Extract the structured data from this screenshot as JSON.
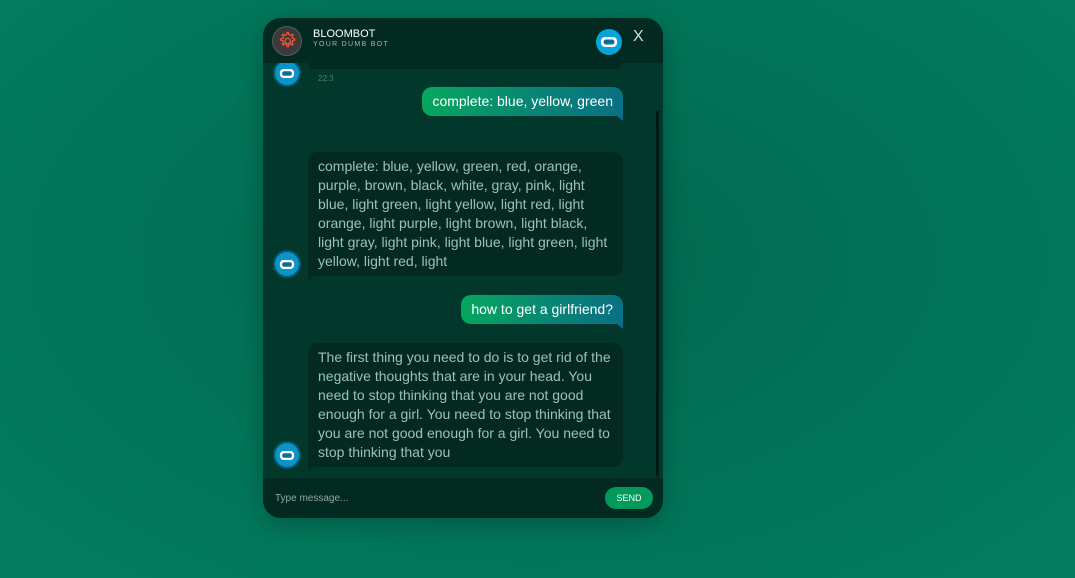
{
  "header": {
    "title": "BLOOMBOT",
    "tagline": "YOUR DUMB BOT",
    "close_label": "X",
    "settings_icon": "gear-icon",
    "bot_icon": "robot-icon"
  },
  "messages": [
    {
      "sender": "bot",
      "timestamp": "22:3"
    },
    {
      "sender": "user",
      "text": "complete: blue, yellow, green"
    },
    {
      "sender": "bot",
      "text": "complete: blue, yellow, green, red, orange, purple, brown, black, white, gray, pink, light blue, light green, light yellow, light red, light orange, light purple, light brown, light black, light gray, light pink, light blue, light green, light yellow, light red, light"
    },
    {
      "sender": "user",
      "text": "how to get a girlfriend?"
    },
    {
      "sender": "bot",
      "text": "The first thing you need to do is to get rid of the negative thoughts that are in your head. You need to stop thinking that you are not good enough for a girl. You need to stop thinking that you are not good enough for a girl. You need to stop thinking that you"
    }
  ],
  "input": {
    "placeholder": "Type message...",
    "value": ""
  },
  "send_label": "SEND",
  "colors": {
    "accent": "#029a5a",
    "bot_avatar": "#0a94c8",
    "panel": "#02382b"
  }
}
